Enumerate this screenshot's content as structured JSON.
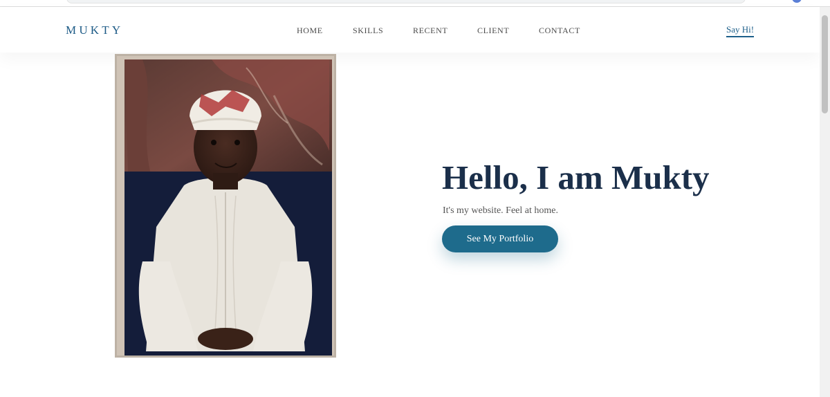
{
  "brand": {
    "name": "MUKTY",
    "color": "#1c5a86"
  },
  "nav": {
    "items": [
      {
        "label": "HOME"
      },
      {
        "label": "SKILLS"
      },
      {
        "label": "RECENT"
      },
      {
        "label": "CLIENT"
      },
      {
        "label": "CONTACT"
      }
    ],
    "cta_label": "Say Hi!"
  },
  "hero": {
    "title": "Hello, I am Mukty",
    "subtitle": "It's my website. Feel at home.",
    "button_label": "See My Portfolio",
    "photo_icon": "portrait-photo"
  },
  "colors": {
    "accent": "#1e6b8c",
    "heading": "#1b2f4a",
    "nav_text": "#4a4a4a"
  }
}
